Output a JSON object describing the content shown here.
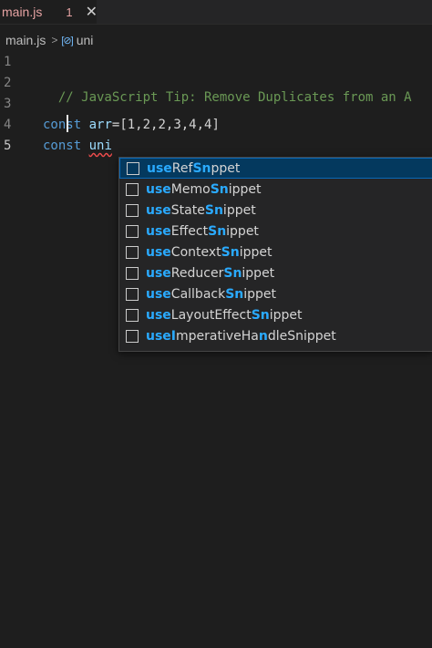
{
  "tab": {
    "filename": "main.js",
    "problem_count": "1",
    "close_glyph": "✕"
  },
  "breadcrumb": {
    "file": "main.js",
    "separator": ">",
    "symbol_icon": "[⊘]",
    "symbol": "uni"
  },
  "gutter": {
    "line_numbers": [
      "1",
      "2",
      "3",
      "4",
      "5"
    ]
  },
  "code": {
    "line2_comment": "// JavaScript Tip: Remove Duplicates from an A",
    "line4": {
      "keyword": "const",
      "name": "arr",
      "eq": "=",
      "value": "[1,2,2,3,4,4]"
    },
    "line5": {
      "keyword": "const",
      "typed": "uni"
    }
  },
  "suggestions": {
    "icon": "snippet-icon",
    "items": [
      {
        "prefix": "use",
        "rest": "Ref",
        "match2": "Sni",
        "tail": "ppet",
        "selected": true
      },
      {
        "prefix": "use",
        "rest": "Memo",
        "match2": "Sni",
        "tail": "ppet"
      },
      {
        "prefix": "use",
        "rest": "State",
        "match2": "Sni",
        "tail": "ppet"
      },
      {
        "prefix": "use",
        "rest": "Effect",
        "match2": "Sni",
        "tail": "ppet"
      },
      {
        "prefix": "use",
        "rest": "Context",
        "match2": "Sni",
        "tail": "ppet"
      },
      {
        "prefix": "use",
        "rest": "Reducer",
        "match2": "Sni",
        "tail": "ppet"
      },
      {
        "prefix": "use",
        "rest": "Callback",
        "match2": "Sni",
        "tail": "ppet"
      },
      {
        "prefix": "use",
        "rest": "Layout",
        "match2": "Effect",
        "tail": "Snippet",
        "alt": true
      },
      {
        "prefix": "use",
        "rest": "Imperative",
        "match2": "Ha",
        "tail": "ndleSnippet",
        "alt2": true
      }
    ]
  },
  "colors": {
    "accent": "#2aaaff",
    "selection": "#04395e",
    "background": "#1e1e1e"
  }
}
